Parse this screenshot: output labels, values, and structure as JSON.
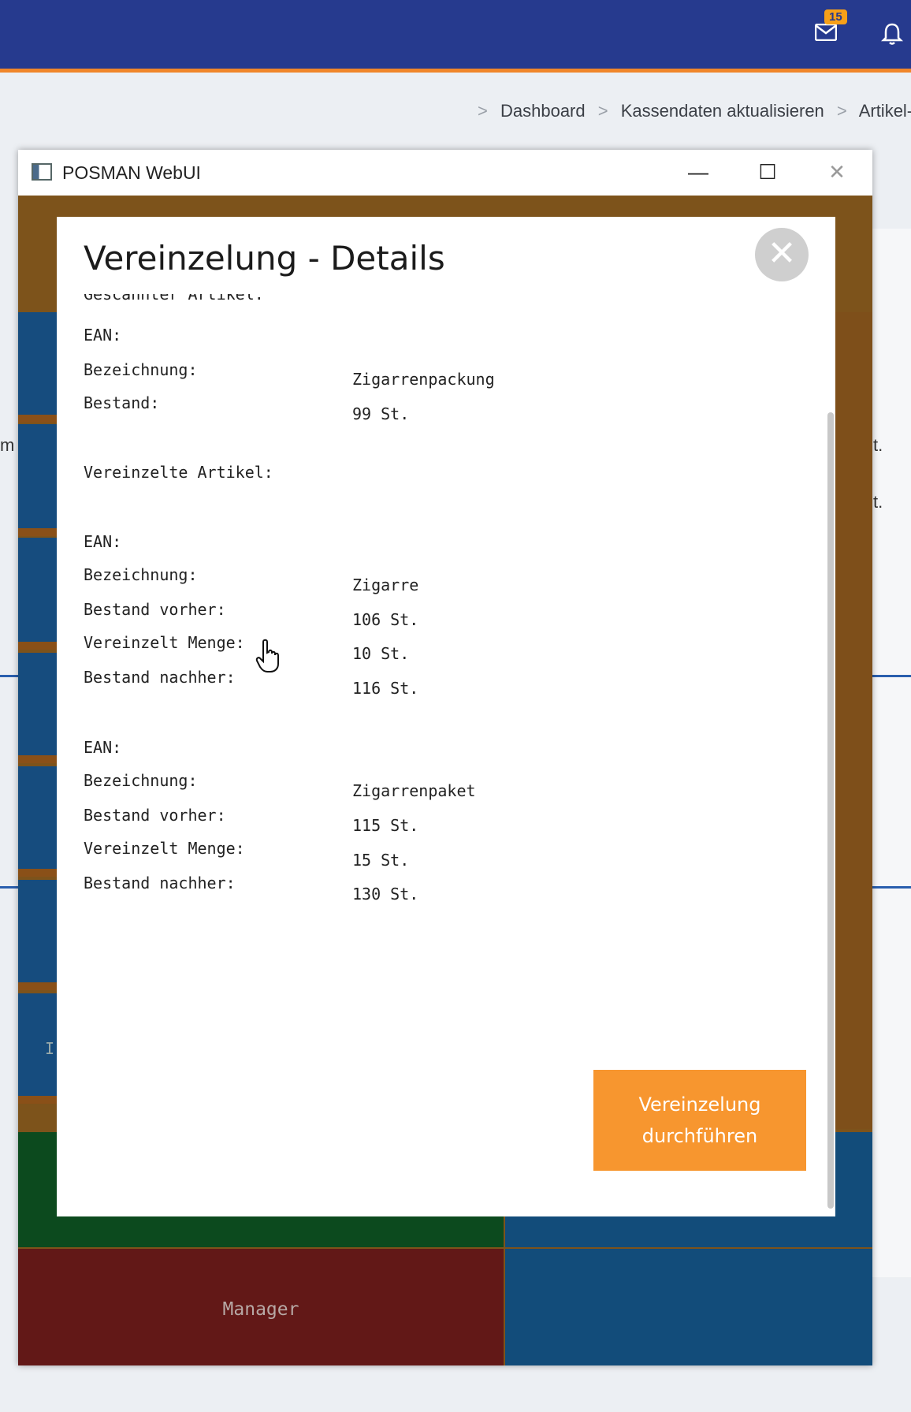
{
  "header": {
    "mail_badge": "15",
    "breadcrumb": [
      "Dashboard",
      "Kassendaten aktualisieren",
      "Artikel-Ko"
    ]
  },
  "window": {
    "title": "POSMAN WebUI",
    "minimize": "—",
    "maximize": "☐",
    "close": "✕"
  },
  "background": {
    "manager_tile": "Manager",
    "frag_m": "m",
    "frag_t1": "t.",
    "frag_t2": "t.",
    "frag_i": "I"
  },
  "modal": {
    "title": "Vereinzelung - Details",
    "close": "✕",
    "partial_heading": "Gescannter Artikel:",
    "scanned": {
      "ean_label": "EAN:",
      "name_label": "Bezeichnung:",
      "name_value": "Zigarrenpackung",
      "stock_label": "Bestand:",
      "stock_value": "99 St."
    },
    "split_heading": "Vereinzelte Artikel:",
    "items": [
      {
        "ean_label": "EAN:",
        "name_label": "Bezeichnung:",
        "name_value": "Zigarre",
        "before_label": "Bestand vorher:",
        "before_value": "106 St.",
        "qty_label": "Vereinzelt Menge:",
        "qty_value": "10 St.",
        "after_label": "Bestand nachher:",
        "after_value": "116 St."
      },
      {
        "ean_label": "EAN:",
        "name_label": "Bezeichnung:",
        "name_value": "Zigarrenpaket",
        "before_label": "Bestand vorher:",
        "before_value": "115 St.",
        "qty_label": "Vereinzelt Menge:",
        "qty_value": "15 St.",
        "after_label": "Bestand nachher:",
        "after_value": "130 St."
      }
    ],
    "action_button": "Vereinzelung durchführen"
  }
}
